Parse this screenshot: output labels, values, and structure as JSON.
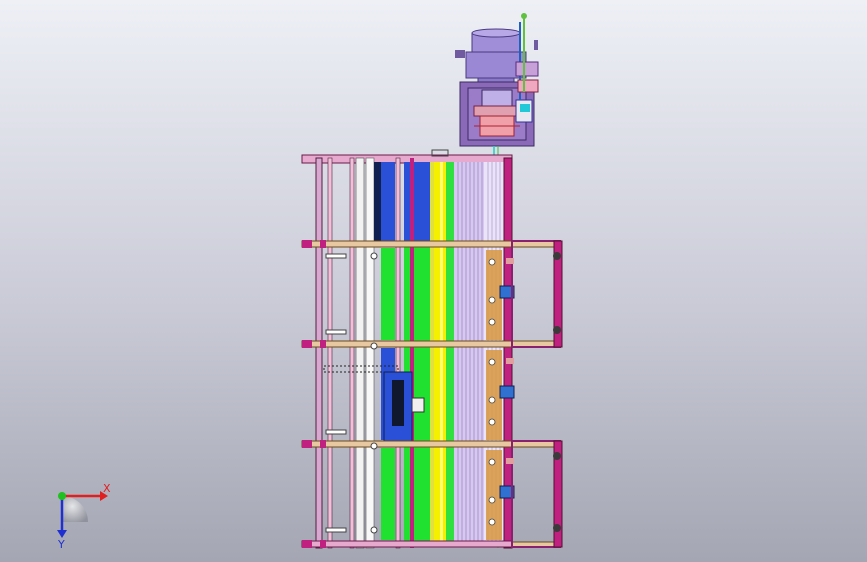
{
  "axes": {
    "x_label": "X",
    "y_label": "Y",
    "x_color": "#e02020",
    "y_color": "#2030d0",
    "origin_color": "#20c020"
  },
  "colors": {
    "frame_pink": "#e8a9cf",
    "frame_magenta": "#c02080",
    "beam_orange": "#d89a48",
    "panel_purple": "#8a6ab8",
    "strip_blue": "#2a50d8",
    "strip_green": "#20e030",
    "strip_yellow": "#f4f000",
    "strip_lilac": "#d8c8f0",
    "motor_violet": "#a08ed8"
  }
}
